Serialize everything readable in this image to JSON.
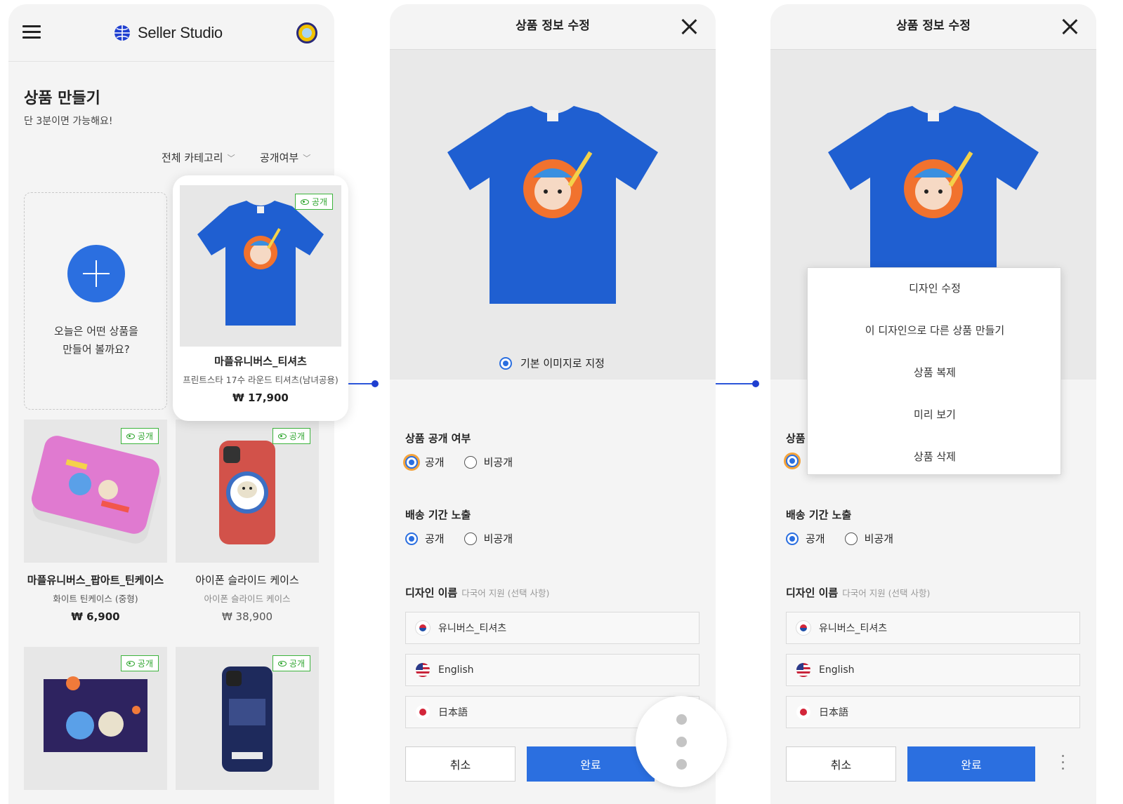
{
  "screen1": {
    "brand": "Seller Studio",
    "title": "상품 만들기",
    "subtitle": "단 3분이면 가능해요!",
    "filters": {
      "category": "전체 카테고리",
      "visibility": "공개여부"
    },
    "create_card": {
      "line1": "오늘은 어떤 상품을",
      "line2": "만들어 볼까요?"
    },
    "featured": {
      "badge": "공개",
      "name": "마플유니버스_티셔츠",
      "desc": "프린트스타 17수 라운드 티셔츠(남녀공용)",
      "price": "₩ 17,900"
    },
    "products": [
      {
        "badge": "공개",
        "name": "마플유니버스_팝아트_틴케이스",
        "desc": "화이트 틴케이스 (중형)",
        "price": "₩ 6,900"
      },
      {
        "badge": "공개",
        "name": "아이폰 슬라이드 케이스",
        "desc": "아이폰 슬라이드 케이스",
        "price": "₩ 38,900"
      },
      {
        "badge": "공개"
      },
      {
        "badge": "공개"
      }
    ]
  },
  "modal": {
    "title": "상품 정보 수정",
    "default_image_label": "기본 이미지로 지정",
    "visibility_section": {
      "label": "상품 공개 여부",
      "options": [
        "공개",
        "비공개"
      ],
      "selected": "공개"
    },
    "shipping_section": {
      "label": "배송 기간 노출",
      "options": [
        "공개",
        "비공개"
      ],
      "selected": "공개"
    },
    "design_name_section": {
      "label": "디자인 이름",
      "hint": "다국어 지원 (선택 사항)",
      "fields": [
        {
          "lang": "ko",
          "flag_icon": "korea-flag-icon",
          "value": "유니버스_티셔츠"
        },
        {
          "lang": "en",
          "flag_icon": "us-flag-icon",
          "value": "English"
        },
        {
          "lang": "ja",
          "flag_icon": "japan-flag-icon",
          "value": "日本語"
        }
      ]
    },
    "cancel_label": "취소",
    "done_label": "완료",
    "screen3_partial_label": "상품"
  },
  "context_menu": {
    "items": [
      "디자인 수정",
      "이 디자인으로 다른 상품 만들기",
      "상품 복제",
      "미리 보기",
      "상품 삭제"
    ]
  },
  "colors": {
    "accent": "#2b6fe0",
    "public_badge": "#3cb43c",
    "focus_ring": "#f4a33a",
    "connector": "#2b55d9"
  }
}
